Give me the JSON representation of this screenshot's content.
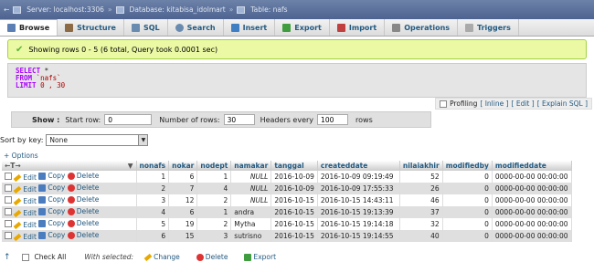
{
  "breadcrumb": {
    "server": "Server: localhost:3306",
    "database": "Database: kitabisa_idolmart",
    "table": "Table: nafs"
  },
  "tabs": [
    {
      "label": "Browse",
      "icon": "browse-icon",
      "color": "#5b7fb5"
    },
    {
      "label": "Structure",
      "icon": "structure-icon",
      "color": "#8b6a45"
    },
    {
      "label": "SQL",
      "icon": "sql-icon",
      "color": "#6a8bb0"
    },
    {
      "label": "Search",
      "icon": "search-icon",
      "color": "#6a8bb0"
    },
    {
      "label": "Insert",
      "icon": "insert-icon",
      "color": "#3f7ec2"
    },
    {
      "label": "Export",
      "icon": "export-icon",
      "color": "#3f9c3f"
    },
    {
      "label": "Import",
      "icon": "import-icon",
      "color": "#c04040"
    },
    {
      "label": "Operations",
      "icon": "operations-icon",
      "color": "#888888"
    },
    {
      "label": "Triggers",
      "icon": "triggers-icon",
      "color": "#888888"
    }
  ],
  "success_message": "Showing rows 0 - 5 (6 total, Query took 0.0001 sec)",
  "sql": {
    "select": "SELECT",
    "star": " *",
    "from": "FROM",
    "table": " `nafs`",
    "limit": "LIMIT",
    "limit_value": " 0 , 30"
  },
  "profiling": {
    "label": "Profiling",
    "inline": "[ Inline ]",
    "edit": "[ Edit ]",
    "explain": "[ Explain SQL ]"
  },
  "nav": {
    "show_label": "Show :",
    "start_row_label": "Start row:",
    "start_row_value": "0",
    "num_rows_label": "Number of rows:",
    "num_rows_value": "30",
    "headers_every_label": "Headers every",
    "headers_every_value": "100",
    "rows_label": "rows"
  },
  "sort": {
    "label": "Sort by key:",
    "value": "None"
  },
  "options_link": "+ Options",
  "table": {
    "columns": [
      "nonafs",
      "nokar",
      "nodept",
      "namakar",
      "tanggal",
      "createddate",
      "nilaiakhir",
      "modifiedby",
      "modifieddate"
    ],
    "edit_label": "Edit",
    "copy_label": "Copy",
    "delete_label": "Delete",
    "rows": [
      [
        "1",
        "6",
        "1",
        "NULL",
        "2016-10-09",
        "2016-10-09 09:19:49",
        "52",
        "0",
        "0000-00-00 00:00:00"
      ],
      [
        "2",
        "7",
        "4",
        "NULL",
        "2016-10-09",
        "2016-10-09 17:55:33",
        "26",
        "0",
        "0000-00-00 00:00:00"
      ],
      [
        "3",
        "12",
        "2",
        "NULL",
        "2016-10-15",
        "2016-10-15 14:43:11",
        "46",
        "0",
        "0000-00-00 00:00:00"
      ],
      [
        "4",
        "6",
        "1",
        "andra",
        "2016-10-15",
        "2016-10-15 19:13:39",
        "37",
        "0",
        "0000-00-00 00:00:00"
      ],
      [
        "5",
        "19",
        "2",
        "Mytha",
        "2016-10-15",
        "2016-10-15 19:14:18",
        "32",
        "0",
        "0000-00-00 00:00:00"
      ],
      [
        "6",
        "15",
        "3",
        "sutrisno",
        "2016-10-15",
        "2016-10-15 19:14:55",
        "40",
        "0",
        "0000-00-00 00:00:00"
      ]
    ]
  },
  "footer": {
    "check_all": "Check All",
    "with_selected": "With selected:",
    "change": "Change",
    "delete": "Delete",
    "export": "Export"
  }
}
